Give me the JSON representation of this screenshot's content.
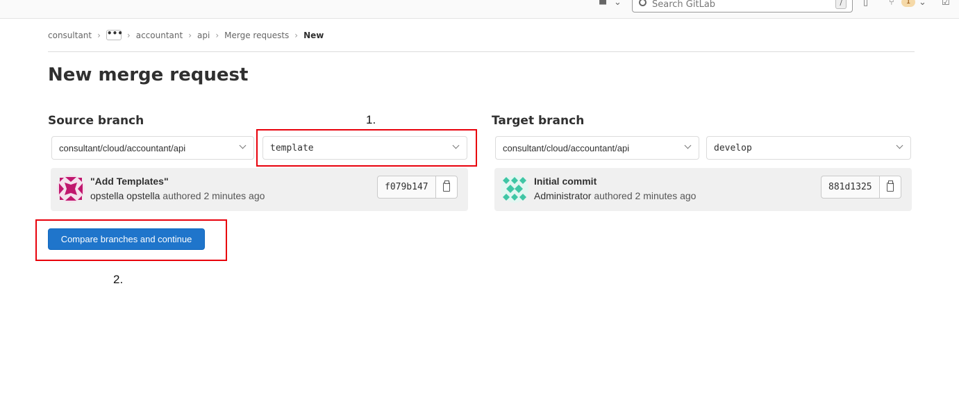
{
  "nav": {
    "search_placeholder": "Search GitLab",
    "search_shortcut": "/",
    "merge_request_count": "1"
  },
  "breadcrumb": {
    "items": [
      "consultant",
      "accountant",
      "api",
      "Merge requests"
    ],
    "more": "•••",
    "current": "New"
  },
  "page": {
    "title": "New merge request"
  },
  "source": {
    "heading": "Source branch",
    "project": "consultant/cloud/accountant/api",
    "branch": "template",
    "commit": {
      "title": "\"Add Templates\"",
      "author": "opstella opstella",
      "time": "authored 2 minutes ago",
      "sha": "f079b147"
    }
  },
  "target": {
    "heading": "Target branch",
    "project": "consultant/cloud/accountant/api",
    "branch": "develop",
    "commit": {
      "title": "Initial commit",
      "author": "Administrator",
      "time": "authored 2 minutes ago",
      "sha": "881d1325"
    }
  },
  "actions": {
    "compare_label": "Compare branches and continue"
  },
  "annotations": {
    "step1": "1.",
    "step2": "2.",
    "color": "#e8000b"
  },
  "colors": {
    "primary": "#1f75cb",
    "source_avatar": "#c0176e",
    "target_avatar": "#3fc6a5"
  }
}
